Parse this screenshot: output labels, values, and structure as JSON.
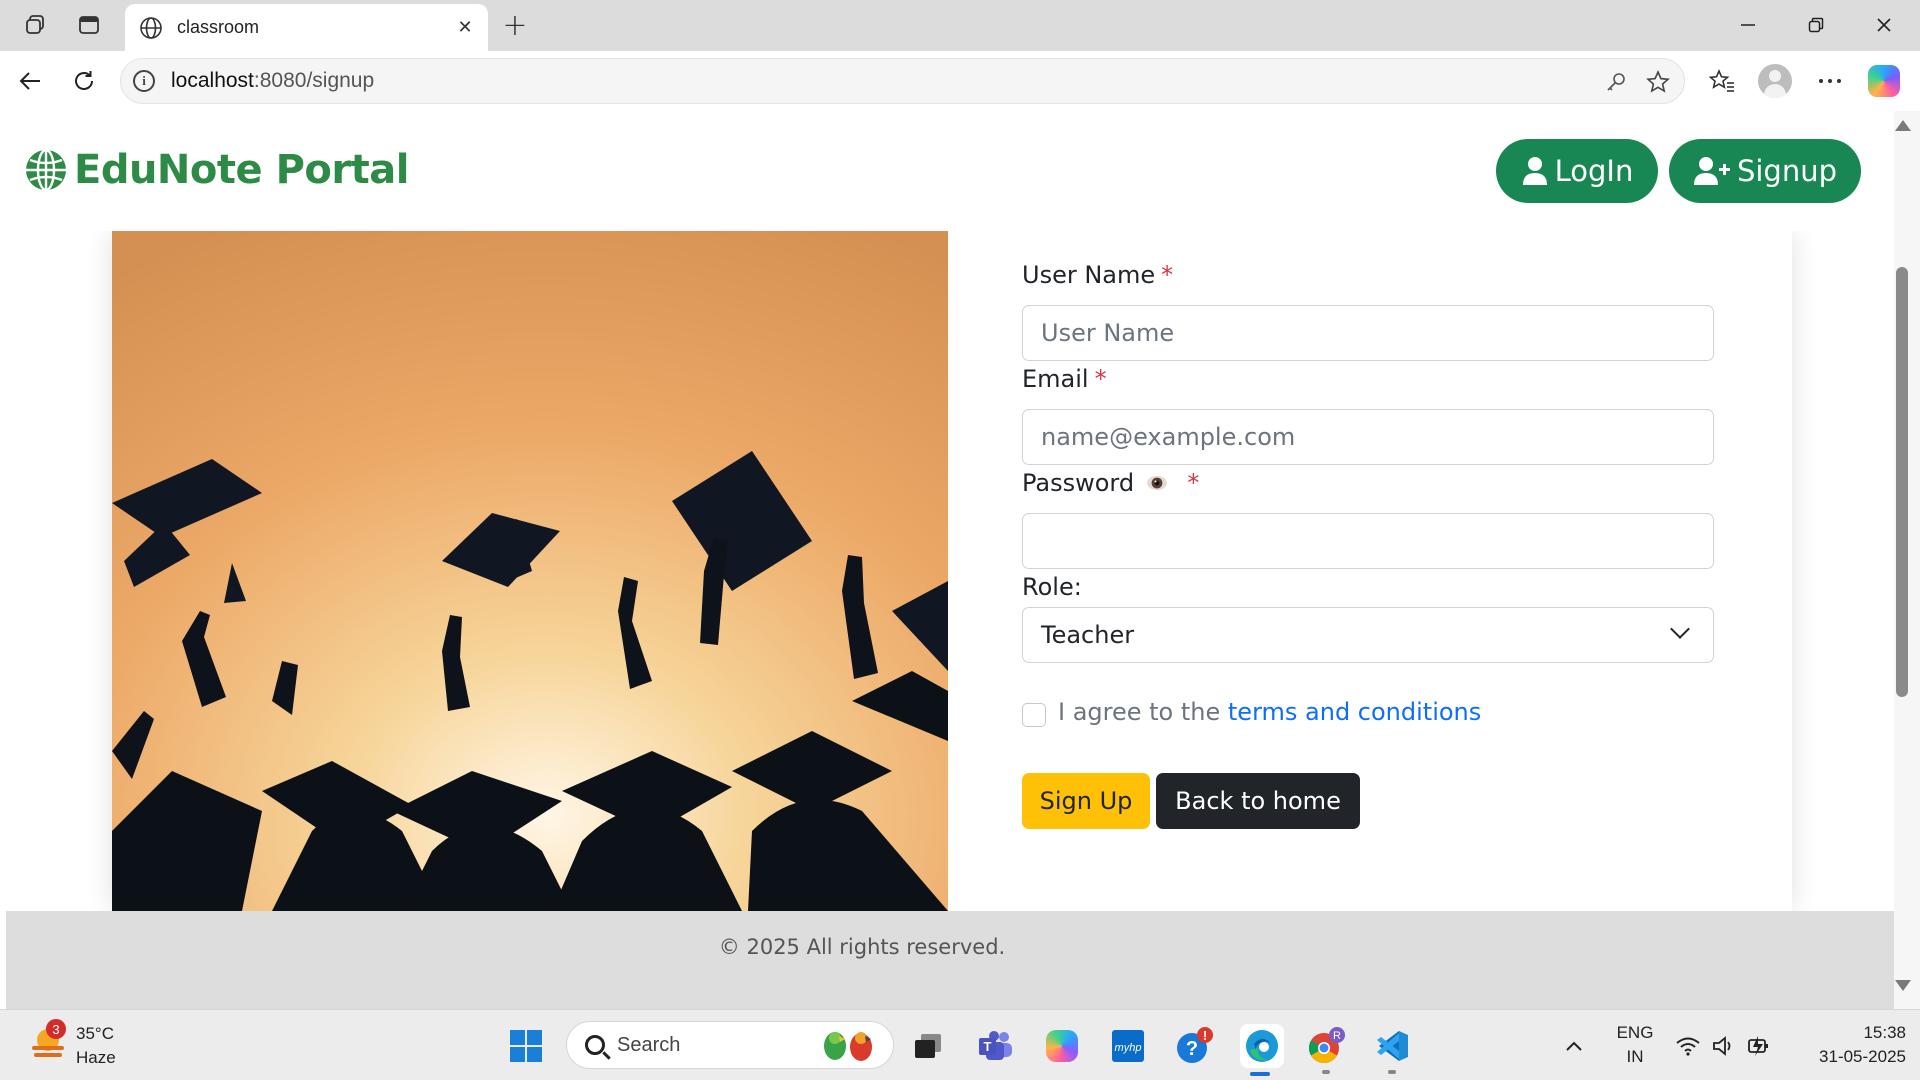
{
  "browser": {
    "tab_title": "classroom",
    "url_host": "localhost",
    "url_path": ":8080/signup"
  },
  "site": {
    "brand": "EduNote Portal",
    "login_label": "LogIn",
    "signup_label": "Signup",
    "brand_color": "#2e8b46",
    "button_color": "#198754"
  },
  "form": {
    "username_label": "User Name",
    "username_placeholder": "User Name",
    "email_label": "Email",
    "email_placeholder": "name@example.com",
    "password_label": "Password",
    "password_value": "",
    "required_mark": "*",
    "role_label": "Role:",
    "role_selected": "Teacher",
    "agree_prefix": "I agree to the ",
    "terms_link": "terms and conditions",
    "signup_button": "Sign Up",
    "back_button": "Back to home"
  },
  "footer": {
    "text": "© 2025 All rights reserved."
  },
  "taskbar": {
    "weather_temp": "35°C",
    "weather_desc": "Haze",
    "weather_badge": "3",
    "search_label": "Search",
    "lang_1": "ENG",
    "lang_2": "IN",
    "time": "15:38",
    "date": "31-05-2025"
  }
}
